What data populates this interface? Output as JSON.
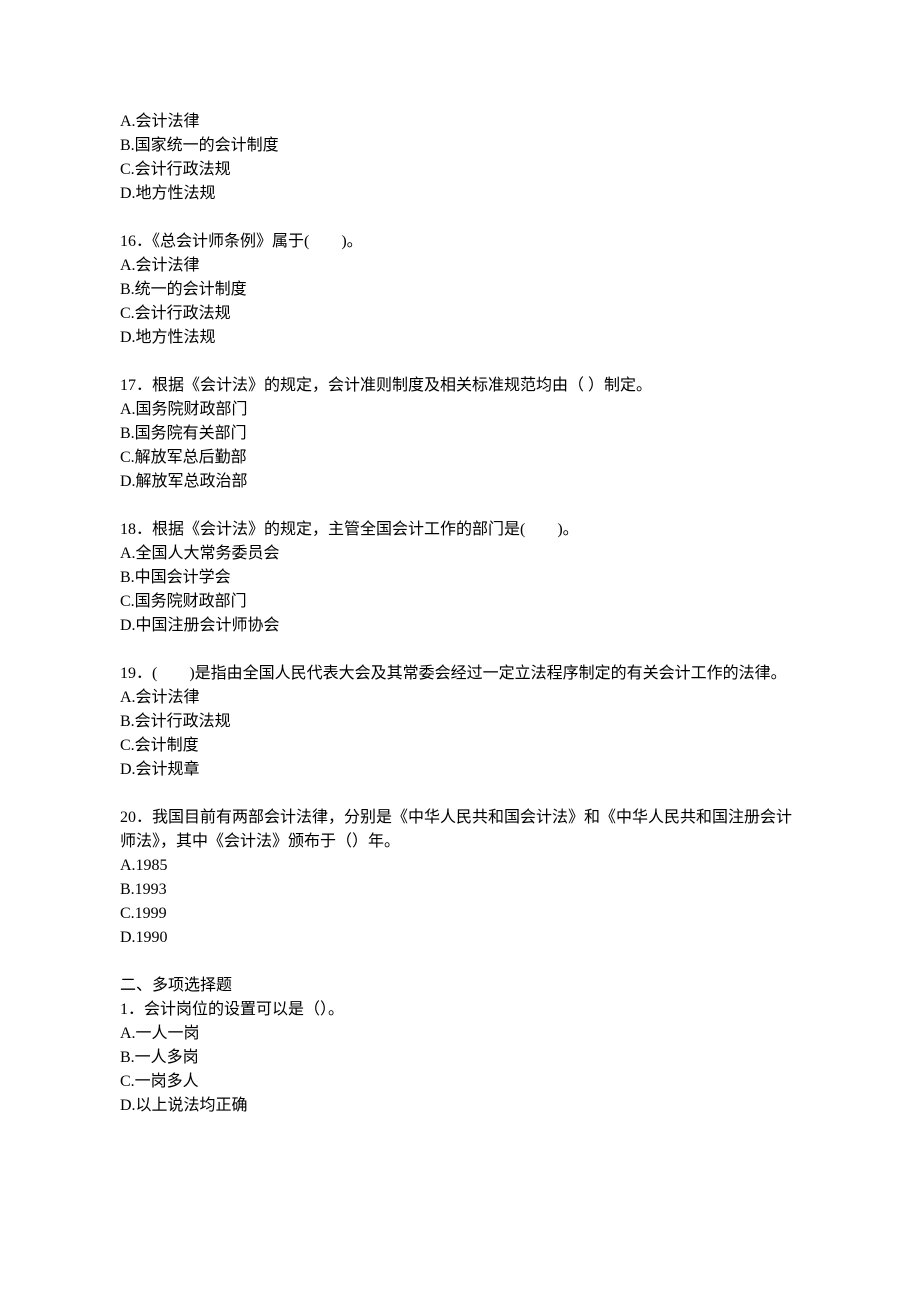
{
  "q15_options": {
    "a": "A.会计法律",
    "b": "B.国家统一的会计制度",
    "c": "C.会计行政法规",
    "d": "D.地方性法规"
  },
  "q16": {
    "stem": "16．《总会计师条例》属于(　　)。",
    "a": "A.会计法律",
    "b": "B.统一的会计制度",
    "c": "C.会计行政法规",
    "d": "D.地方性法规"
  },
  "q17": {
    "stem": "17．根据《会计法》的规定，会计准则制度及相关标准规范均由（  ）制定。",
    "a": "A.国务院财政部门",
    "b": "B.国务院有关部门",
    "c": "C.解放军总后勤部",
    "d": "D.解放军总政治部"
  },
  "q18": {
    "stem": "18．根据《会计法》的规定，主管全国会计工作的部门是(　　)。",
    "a": "A.全国人大常务委员会",
    "b": "B.中国会计学会",
    "c": "C.国务院财政部门",
    "d": "D.中国注册会计师协会"
  },
  "q19": {
    "stem": "19．(　　)是指由全国人民代表大会及其常委会经过一定立法程序制定的有关会计工作的法律。",
    "a": "A.会计法律",
    "b": "B.会计行政法规",
    "c": "C.会计制度",
    "d": "D.会计规章"
  },
  "q20": {
    "stem": "20．我国目前有两部会计法律，分别是《中华人民共和国会计法》和《中华人民共和国注册会计师法》，其中《会计法》颁布于（）年。",
    "a": "A.1985",
    "b": "B.1993",
    "c": "C.1999",
    "d": "D.1990"
  },
  "section2": {
    "title": "二、多项选择题",
    "q1": {
      "stem": "1．会计岗位的设置可以是（）。",
      "a": "A.一人一岗",
      "b": "B.一人多岗",
      "c": "C.一岗多人",
      "d": "D.以上说法均正确"
    }
  }
}
